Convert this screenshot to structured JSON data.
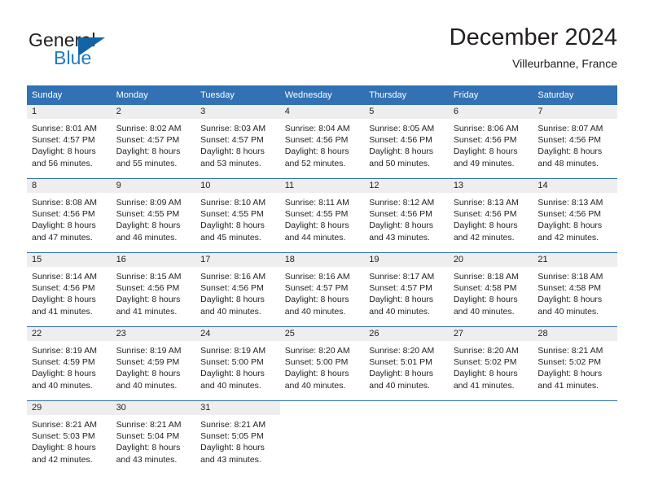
{
  "brand": {
    "name_part1": "General",
    "name_part2": "Blue",
    "logo_icon": "triangle-logo-icon"
  },
  "header": {
    "title": "December 2024",
    "subtitle": "Villeurbanne, France"
  },
  "colors": {
    "header_blue": "#3271b4",
    "separator_blue": "#2f6fb2",
    "daynum_band": "#eeeeee",
    "brand_blue": "#1f7ac4",
    "logo_blue": "#1464a5",
    "text": "#231f20"
  },
  "weekday_headers": [
    "Sunday",
    "Monday",
    "Tuesday",
    "Wednesday",
    "Thursday",
    "Friday",
    "Saturday"
  ],
  "weeks": [
    [
      {
        "day": "1",
        "sunrise": "Sunrise: 8:01 AM",
        "sunset": "Sunset: 4:57 PM",
        "daylight_line1": "Daylight: 8 hours",
        "daylight_line2": "and 56 minutes."
      },
      {
        "day": "2",
        "sunrise": "Sunrise: 8:02 AM",
        "sunset": "Sunset: 4:57 PM",
        "daylight_line1": "Daylight: 8 hours",
        "daylight_line2": "and 55 minutes."
      },
      {
        "day": "3",
        "sunrise": "Sunrise: 8:03 AM",
        "sunset": "Sunset: 4:57 PM",
        "daylight_line1": "Daylight: 8 hours",
        "daylight_line2": "and 53 minutes."
      },
      {
        "day": "4",
        "sunrise": "Sunrise: 8:04 AM",
        "sunset": "Sunset: 4:56 PM",
        "daylight_line1": "Daylight: 8 hours",
        "daylight_line2": "and 52 minutes."
      },
      {
        "day": "5",
        "sunrise": "Sunrise: 8:05 AM",
        "sunset": "Sunset: 4:56 PM",
        "daylight_line1": "Daylight: 8 hours",
        "daylight_line2": "and 50 minutes."
      },
      {
        "day": "6",
        "sunrise": "Sunrise: 8:06 AM",
        "sunset": "Sunset: 4:56 PM",
        "daylight_line1": "Daylight: 8 hours",
        "daylight_line2": "and 49 minutes."
      },
      {
        "day": "7",
        "sunrise": "Sunrise: 8:07 AM",
        "sunset": "Sunset: 4:56 PM",
        "daylight_line1": "Daylight: 8 hours",
        "daylight_line2": "and 48 minutes."
      }
    ],
    [
      {
        "day": "8",
        "sunrise": "Sunrise: 8:08 AM",
        "sunset": "Sunset: 4:56 PM",
        "daylight_line1": "Daylight: 8 hours",
        "daylight_line2": "and 47 minutes."
      },
      {
        "day": "9",
        "sunrise": "Sunrise: 8:09 AM",
        "sunset": "Sunset: 4:55 PM",
        "daylight_line1": "Daylight: 8 hours",
        "daylight_line2": "and 46 minutes."
      },
      {
        "day": "10",
        "sunrise": "Sunrise: 8:10 AM",
        "sunset": "Sunset: 4:55 PM",
        "daylight_line1": "Daylight: 8 hours",
        "daylight_line2": "and 45 minutes."
      },
      {
        "day": "11",
        "sunrise": "Sunrise: 8:11 AM",
        "sunset": "Sunset: 4:55 PM",
        "daylight_line1": "Daylight: 8 hours",
        "daylight_line2": "and 44 minutes."
      },
      {
        "day": "12",
        "sunrise": "Sunrise: 8:12 AM",
        "sunset": "Sunset: 4:56 PM",
        "daylight_line1": "Daylight: 8 hours",
        "daylight_line2": "and 43 minutes."
      },
      {
        "day": "13",
        "sunrise": "Sunrise: 8:13 AM",
        "sunset": "Sunset: 4:56 PM",
        "daylight_line1": "Daylight: 8 hours",
        "daylight_line2": "and 42 minutes."
      },
      {
        "day": "14",
        "sunrise": "Sunrise: 8:13 AM",
        "sunset": "Sunset: 4:56 PM",
        "daylight_line1": "Daylight: 8 hours",
        "daylight_line2": "and 42 minutes."
      }
    ],
    [
      {
        "day": "15",
        "sunrise": "Sunrise: 8:14 AM",
        "sunset": "Sunset: 4:56 PM",
        "daylight_line1": "Daylight: 8 hours",
        "daylight_line2": "and 41 minutes."
      },
      {
        "day": "16",
        "sunrise": "Sunrise: 8:15 AM",
        "sunset": "Sunset: 4:56 PM",
        "daylight_line1": "Daylight: 8 hours",
        "daylight_line2": "and 41 minutes."
      },
      {
        "day": "17",
        "sunrise": "Sunrise: 8:16 AM",
        "sunset": "Sunset: 4:56 PM",
        "daylight_line1": "Daylight: 8 hours",
        "daylight_line2": "and 40 minutes."
      },
      {
        "day": "18",
        "sunrise": "Sunrise: 8:16 AM",
        "sunset": "Sunset: 4:57 PM",
        "daylight_line1": "Daylight: 8 hours",
        "daylight_line2": "and 40 minutes."
      },
      {
        "day": "19",
        "sunrise": "Sunrise: 8:17 AM",
        "sunset": "Sunset: 4:57 PM",
        "daylight_line1": "Daylight: 8 hours",
        "daylight_line2": "and 40 minutes."
      },
      {
        "day": "20",
        "sunrise": "Sunrise: 8:18 AM",
        "sunset": "Sunset: 4:58 PM",
        "daylight_line1": "Daylight: 8 hours",
        "daylight_line2": "and 40 minutes."
      },
      {
        "day": "21",
        "sunrise": "Sunrise: 8:18 AM",
        "sunset": "Sunset: 4:58 PM",
        "daylight_line1": "Daylight: 8 hours",
        "daylight_line2": "and 40 minutes."
      }
    ],
    [
      {
        "day": "22",
        "sunrise": "Sunrise: 8:19 AM",
        "sunset": "Sunset: 4:59 PM",
        "daylight_line1": "Daylight: 8 hours",
        "daylight_line2": "and 40 minutes."
      },
      {
        "day": "23",
        "sunrise": "Sunrise: 8:19 AM",
        "sunset": "Sunset: 4:59 PM",
        "daylight_line1": "Daylight: 8 hours",
        "daylight_line2": "and 40 minutes."
      },
      {
        "day": "24",
        "sunrise": "Sunrise: 8:19 AM",
        "sunset": "Sunset: 5:00 PM",
        "daylight_line1": "Daylight: 8 hours",
        "daylight_line2": "and 40 minutes."
      },
      {
        "day": "25",
        "sunrise": "Sunrise: 8:20 AM",
        "sunset": "Sunset: 5:00 PM",
        "daylight_line1": "Daylight: 8 hours",
        "daylight_line2": "and 40 minutes."
      },
      {
        "day": "26",
        "sunrise": "Sunrise: 8:20 AM",
        "sunset": "Sunset: 5:01 PM",
        "daylight_line1": "Daylight: 8 hours",
        "daylight_line2": "and 40 minutes."
      },
      {
        "day": "27",
        "sunrise": "Sunrise: 8:20 AM",
        "sunset": "Sunset: 5:02 PM",
        "daylight_line1": "Daylight: 8 hours",
        "daylight_line2": "and 41 minutes."
      },
      {
        "day": "28",
        "sunrise": "Sunrise: 8:21 AM",
        "sunset": "Sunset: 5:02 PM",
        "daylight_line1": "Daylight: 8 hours",
        "daylight_line2": "and 41 minutes."
      }
    ],
    [
      {
        "day": "29",
        "sunrise": "Sunrise: 8:21 AM",
        "sunset": "Sunset: 5:03 PM",
        "daylight_line1": "Daylight: 8 hours",
        "daylight_line2": "and 42 minutes."
      },
      {
        "day": "30",
        "sunrise": "Sunrise: 8:21 AM",
        "sunset": "Sunset: 5:04 PM",
        "daylight_line1": "Daylight: 8 hours",
        "daylight_line2": "and 43 minutes."
      },
      {
        "day": "31",
        "sunrise": "Sunrise: 8:21 AM",
        "sunset": "Sunset: 5:05 PM",
        "daylight_line1": "Daylight: 8 hours",
        "daylight_line2": "and 43 minutes."
      },
      {
        "day": "",
        "sunrise": "",
        "sunset": "",
        "daylight_line1": "",
        "daylight_line2": ""
      },
      {
        "day": "",
        "sunrise": "",
        "sunset": "",
        "daylight_line1": "",
        "daylight_line2": ""
      },
      {
        "day": "",
        "sunrise": "",
        "sunset": "",
        "daylight_line1": "",
        "daylight_line2": ""
      },
      {
        "day": "",
        "sunrise": "",
        "sunset": "",
        "daylight_line1": "",
        "daylight_line2": ""
      }
    ]
  ]
}
